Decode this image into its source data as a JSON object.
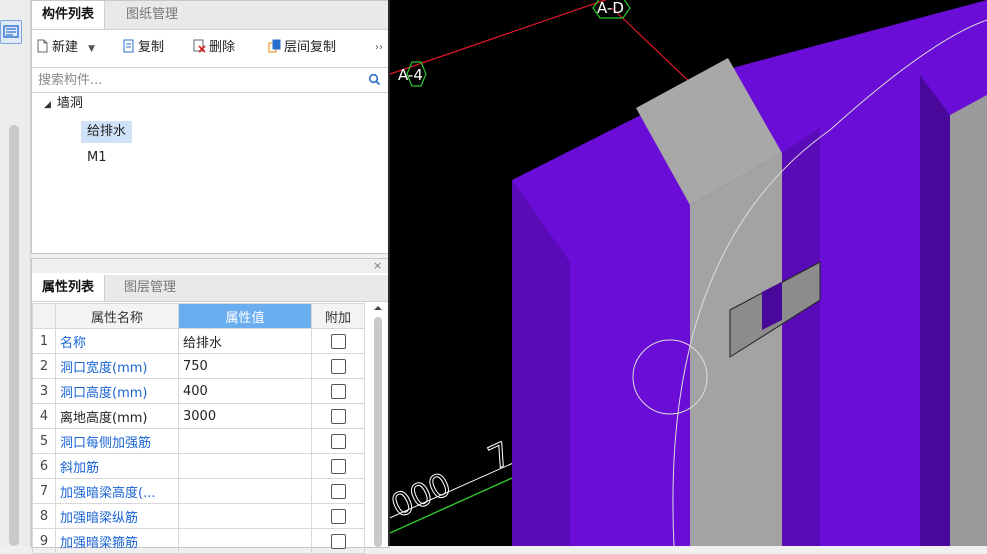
{
  "component_panel": {
    "tabs": [
      "构件列表",
      "图纸管理"
    ],
    "toolbar": {
      "new_label": "新建",
      "copy_label": "复制",
      "delete_label": "删除",
      "floor_copy_label": "层间复制",
      "more_label": "››"
    },
    "search_placeholder": "搜索构件...",
    "tree": {
      "root_label": "墙洞",
      "items": [
        "给排水",
        "M1"
      ]
    }
  },
  "property_panel": {
    "tabs": [
      "属性列表",
      "图层管理"
    ],
    "close_label": "×",
    "headers": {
      "name": "属性名称",
      "value": "属性值",
      "extra": "附加"
    },
    "rows": [
      {
        "idx": "1",
        "name": "名称",
        "value": "给排水",
        "blue": true
      },
      {
        "idx": "2",
        "name": "洞口宽度(mm)",
        "value": "750",
        "blue": true
      },
      {
        "idx": "3",
        "name": "洞口高度(mm)",
        "value": "400",
        "blue": true
      },
      {
        "idx": "4",
        "name": "离地高度(mm)",
        "value": "3000",
        "blue": false
      },
      {
        "idx": "5",
        "name": "洞口每侧加强筋",
        "value": "",
        "blue": true
      },
      {
        "idx": "6",
        "name": "斜加筋",
        "value": "",
        "blue": true
      },
      {
        "idx": "7",
        "name": "加强暗梁高度(...",
        "value": "",
        "blue": true
      },
      {
        "idx": "8",
        "name": "加强暗梁纵筋",
        "value": "",
        "blue": true
      },
      {
        "idx": "9",
        "name": "加强暗梁箍筋",
        "value": "",
        "blue": true
      }
    ]
  },
  "viewport": {
    "axis_label_top": "A-D",
    "axis_label_left": "A-4",
    "dim_text": "000",
    "colors": {
      "wall": "#6a0dd6",
      "wall_dark": "#4a089a",
      "column": "#a8a8a8",
      "column_dark": "#8c8c8c",
      "grid_red": "#e0162a",
      "grid_green": "#2ec72e"
    }
  }
}
